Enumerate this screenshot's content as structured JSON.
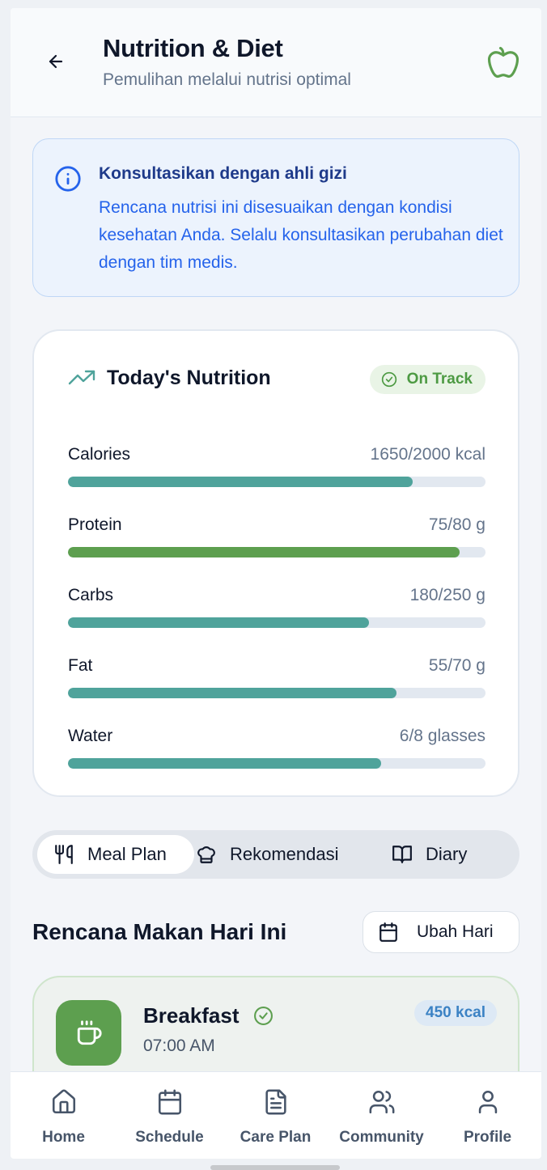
{
  "header": {
    "title": "Nutrition & Diet",
    "subtitle": "Pemulihan melalui nutrisi optimal",
    "back_icon": "arrow-left-icon",
    "right_icon": "apple-icon"
  },
  "info": {
    "title": "Konsultasikan dengan ahli gizi",
    "text": "Rencana nutrisi ini disesuaikan dengan kondisi kesehatan Anda. Selalu konsultasikan perubahan diet dengan tim medis."
  },
  "nutrition": {
    "title": "Today's Nutrition",
    "status": "On Track",
    "metrics": [
      {
        "label": "Calories",
        "value": "1650/2000 kcal",
        "fraction": 0.825,
        "color": "#4fa39b"
      },
      {
        "label": "Protein",
        "value": "75/80 g",
        "fraction": 0.9375,
        "color": "#5d9f4f"
      },
      {
        "label": "Carbs",
        "value": "180/250 g",
        "fraction": 0.72,
        "color": "#4fa39b"
      },
      {
        "label": "Fat",
        "value": "55/70 g",
        "fraction": 0.786,
        "color": "#4fa39b"
      },
      {
        "label": "Water",
        "value": "6/8 glasses",
        "fraction": 0.75,
        "color": "#4fa39b"
      }
    ]
  },
  "tabs": [
    {
      "label": "Meal Plan",
      "icon": "utensils-icon",
      "active": true
    },
    {
      "label": "Rekomendasi",
      "icon": "chef-hat-icon",
      "active": false
    },
    {
      "label": "Diary",
      "icon": "book-open-icon",
      "active": false
    }
  ],
  "section": {
    "title": "Rencana Makan Hari Ini",
    "change_day_label": "Ubah Hari"
  },
  "meal": {
    "name": "Breakfast",
    "time": "07:00 AM",
    "kcal": "450 kcal"
  },
  "nav": [
    {
      "label": "Home",
      "icon": "home-icon"
    },
    {
      "label": "Schedule",
      "icon": "calendar-icon"
    },
    {
      "label": "Care Plan",
      "icon": "document-icon"
    },
    {
      "label": "Community",
      "icon": "users-icon"
    },
    {
      "label": "Profile",
      "icon": "user-icon"
    }
  ],
  "colors": {
    "accent_teal": "#4fa39b",
    "accent_green": "#5d9f4f",
    "info_blue": "#2563eb"
  }
}
